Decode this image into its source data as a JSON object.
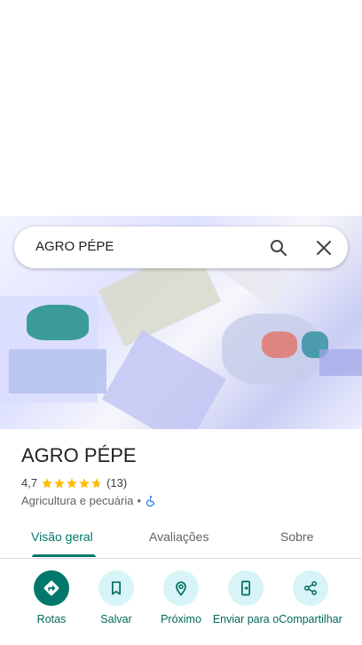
{
  "search": {
    "query": "AGRO PÉPE"
  },
  "place": {
    "name": "AGRO PÉPE",
    "rating": "4,7",
    "stars": 4.7,
    "review_count": "(13)",
    "category": "Agricultura e pecuária",
    "separator": "•"
  },
  "tabs": [
    {
      "label": "Visão geral",
      "active": true
    },
    {
      "label": "Avaliações",
      "active": false
    },
    {
      "label": "Sobre",
      "active": false
    }
  ],
  "actions": [
    {
      "label": "Rotas",
      "icon": "directions-icon"
    },
    {
      "label": "Salvar",
      "icon": "bookmark-icon"
    },
    {
      "label": "Próximo",
      "icon": "nearby-icon"
    },
    {
      "label": "Enviar para o",
      "icon": "send-to-phone-icon"
    },
    {
      "label": "Compartilhar",
      "icon": "share-icon"
    }
  ],
  "colors": {
    "accent": "#00796b",
    "action_bg": "#d7f4f7",
    "star": "#fbbc04"
  }
}
